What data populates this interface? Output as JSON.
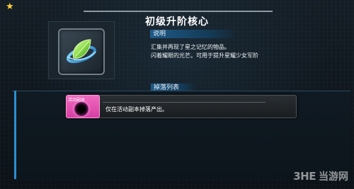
{
  "title": "初级升阶核心",
  "description": {
    "header": "说明",
    "lines": [
      "汇集并再现了星之记忆的物品。",
      "闪着耀眼的光芒。可用于提升星耀少女军阶"
    ]
  },
  "drop_list": {
    "header": "掉落列表",
    "items": [
      {
        "tag": "活动副本",
        "text": "仅在活动副本掉落产出。"
      }
    ]
  },
  "item": {
    "icon": "green-crystal-core-icon"
  },
  "watermark": {
    "logo": "3HE",
    "site": "当游网"
  },
  "colors": {
    "accent_blue": "#1e5a86",
    "event_tag_pink": "#e04fb0",
    "star_yellow": "#ffd23a"
  }
}
